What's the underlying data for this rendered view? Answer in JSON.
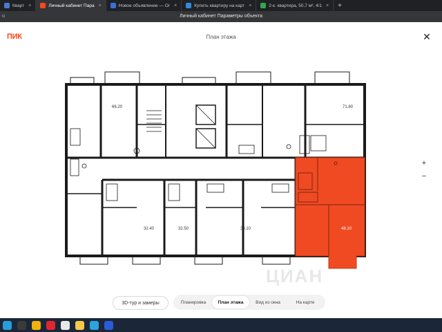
{
  "browser": {
    "tabs": [
      {
        "label": "Кварт",
        "favicon_color": "#4a7bd0",
        "active": false
      },
      {
        "label": "Личный кабинет Пара",
        "favicon_color": "#ff4619",
        "active": true
      },
      {
        "label": "Новое объявление — Ог",
        "favicon_color": "#3b6fd8",
        "active": false
      },
      {
        "label": "Купить квартиру на карт",
        "favicon_color": "#2f8ae0",
        "active": false
      },
      {
        "label": "2-к. квартира, 50,7 м², 4/1",
        "favicon_color": "#2fa84f",
        "active": false
      }
    ],
    "new_tab_symbol": "+",
    "tab_close_symbol": "×",
    "window_title": "Личный кабинет Параметры объекта",
    "url_fragment": "u"
  },
  "header": {
    "logo": "ПИК",
    "title": "План этажа",
    "close_symbol": "✕"
  },
  "floor_plan": {
    "selected_color": "#f04a23",
    "apartments": [
      {
        "area": "66.20",
        "selected": false
      },
      {
        "area": "71.80",
        "selected": false
      },
      {
        "area": "32.40",
        "selected": false
      },
      {
        "area": "32.50",
        "selected": false
      },
      {
        "area": "36.10",
        "selected": false
      },
      {
        "area": "48.10",
        "selected": true
      }
    ]
  },
  "zoom": {
    "in": "+",
    "out": "−"
  },
  "watermark": "ЦИАН",
  "controls": {
    "tour_button": "3D-тур и замеры",
    "view_tabs": [
      "Планировка",
      "План этажа",
      "Вид из окна",
      "На карте"
    ],
    "active_view_tab": "План этажа"
  },
  "taskbar": {
    "icons": [
      {
        "name": "start-icon",
        "color": "#2a9cd8"
      },
      {
        "name": "explorer-icon",
        "color": "#3a3a3a"
      },
      {
        "name": "chrome-icon",
        "color": "#f2b20c"
      },
      {
        "name": "opera-icon",
        "color": "#e0262f"
      },
      {
        "name": "yandex-icon",
        "color": "#e8e8e8"
      },
      {
        "name": "files-icon",
        "color": "#f4c84a"
      },
      {
        "name": "telegram-icon",
        "color": "#2aa3df"
      },
      {
        "name": "vpn-icon",
        "color": "#2a5bd8"
      }
    ]
  }
}
